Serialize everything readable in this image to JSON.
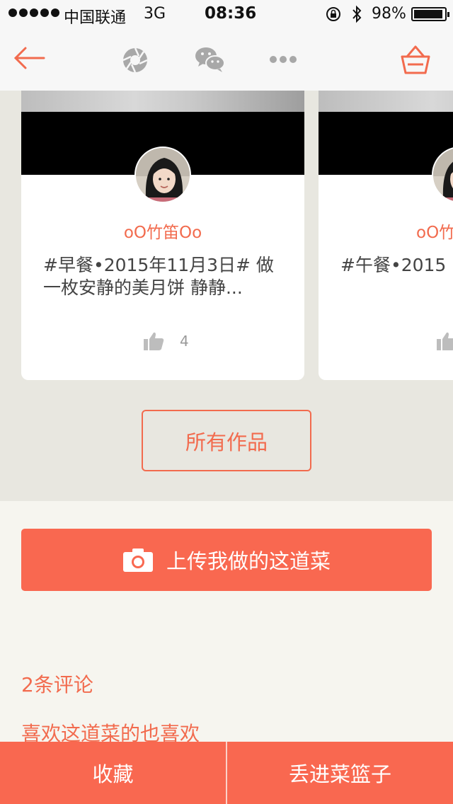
{
  "status_bar": {
    "carrier": "中国联通",
    "network": "3G",
    "time": "08:36",
    "battery": "98%"
  },
  "nav": {
    "icons": [
      "back-arrow-icon",
      "camera-shutter-icon",
      "wechat-icon",
      "more-icon",
      "basket-icon"
    ]
  },
  "works": [
    {
      "author": "oO竹笛Oo",
      "description": "#早餐•2015年11月3日# 做一枚安静的美月饼 静静...",
      "likes": "4"
    },
    {
      "author": "oO竹",
      "description": "#午餐•2015",
      "likes": ""
    }
  ],
  "all_works_label": "所有作品",
  "upload_label": "上传我做的这道菜",
  "comments_label": "2条评论",
  "also_like_label": "喜欢这道菜的也喜欢",
  "bottom": {
    "favorite_label": "收藏",
    "add_to_basket_label": "丢进菜篮子"
  },
  "colors": {
    "accent": "#f96850",
    "accent_text": "#f26b4e",
    "gallery_bg": "#e8e7e0",
    "page_bg": "#f6f5ef"
  }
}
